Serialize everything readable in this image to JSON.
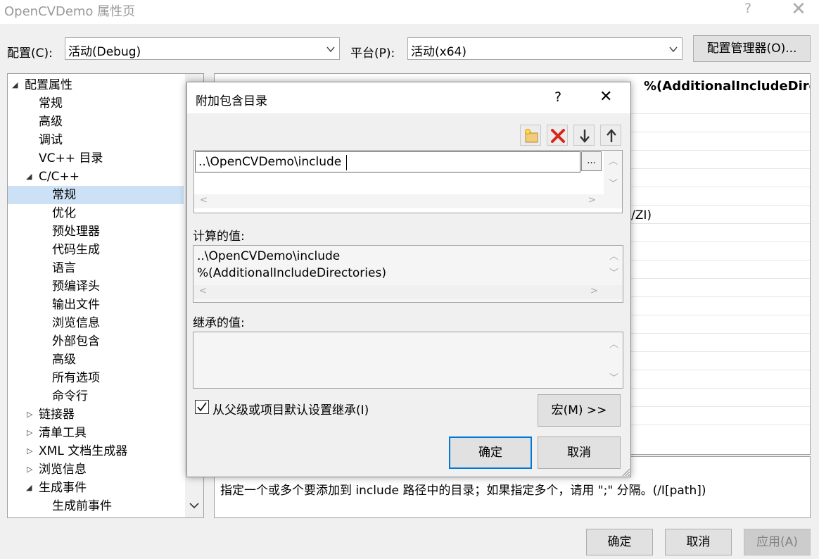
{
  "window": {
    "title": "OpenCVDemo 属性页",
    "help": "?",
    "close": "✕"
  },
  "config": {
    "config_label": "配置(C):",
    "config_value": "活动(Debug)",
    "platform_label": "平台(P):",
    "platform_value": "活动(x64)",
    "manager_button": "配置管理器(O)..."
  },
  "tree": {
    "items": [
      {
        "label": "配置属性",
        "expanded": true
      },
      {
        "label": "常规"
      },
      {
        "label": "高级"
      },
      {
        "label": "调试"
      },
      {
        "label": "VC++ 目录"
      },
      {
        "label": "C/C++",
        "expanded": true
      },
      {
        "label": "常规",
        "selected": true
      },
      {
        "label": "优化"
      },
      {
        "label": "预处理器"
      },
      {
        "label": "代码生成"
      },
      {
        "label": "语言"
      },
      {
        "label": "预编译头"
      },
      {
        "label": "输出文件"
      },
      {
        "label": "浏览信息"
      },
      {
        "label": "外部包含"
      },
      {
        "label": "高级"
      },
      {
        "label": "所有选项"
      },
      {
        "label": "命令行"
      },
      {
        "label": "链接器",
        "expanded": false
      },
      {
        "label": "清单工具",
        "expanded": false
      },
      {
        "label": "XML 文档生成器",
        "expanded": false
      },
      {
        "label": "浏览信息",
        "expanded": false
      },
      {
        "label": "生成事件",
        "expanded": true
      },
      {
        "label": "生成前事件"
      }
    ]
  },
  "grid": {
    "header_value": "%(AdditionalIncludeDirectories)",
    "partial_value": "/ZI)"
  },
  "description": "指定一个或多个要添加到 include 路径中的目录；如果指定多个，请用 \";\" 分隔。(/I[path])",
  "footer": {
    "ok": "确定",
    "cancel": "取消",
    "apply": "应用(A)"
  },
  "dialog": {
    "title": "附加包含目录",
    "help": "?",
    "close": "✕",
    "toolbar": [
      "new-line-icon",
      "delete-icon",
      "move-down-icon",
      "move-up-icon"
    ],
    "entry_value": "..\\OpenCVDemo\\include",
    "browse_button": "...",
    "computed_label": "计算的值:",
    "computed_lines": [
      "..\\OpenCVDemo\\include",
      "%(AdditionalIncludeDirectories)"
    ],
    "inherited_label": "继承的值:",
    "inherit_checkbox": "从父级或项目默认设置继承(I)",
    "inherit_checked": true,
    "macro_button": "宏(M) >>",
    "ok_button": "确定",
    "cancel_button": "取消"
  }
}
